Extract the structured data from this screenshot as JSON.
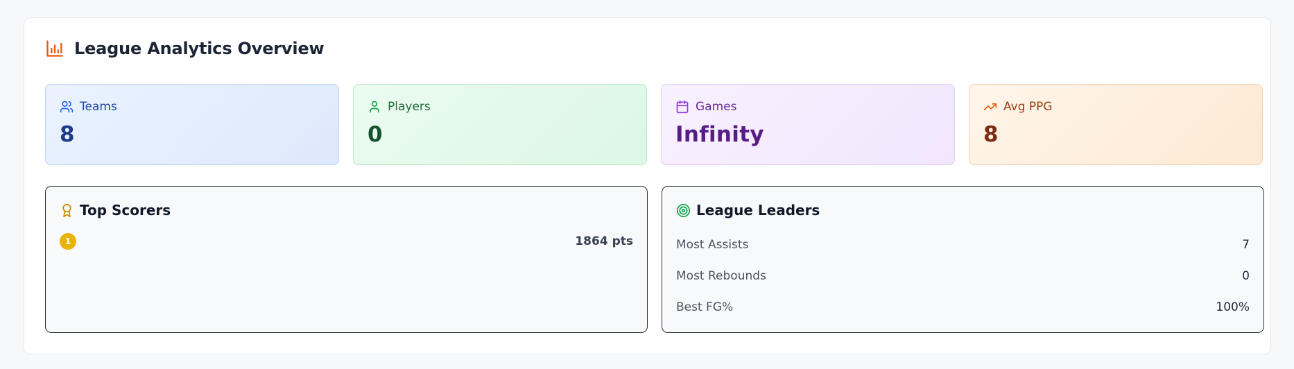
{
  "header": {
    "title": "League Analytics Overview",
    "icon": "bar-chart-icon",
    "accent": "#ea580c"
  },
  "stats": [
    {
      "label": "Teams",
      "value": "8",
      "icon": "users-icon",
      "color": "#2563eb"
    },
    {
      "label": "Players",
      "value": "0",
      "icon": "user-icon",
      "color": "#16a34a"
    },
    {
      "label": "Games",
      "value": "Infinity",
      "icon": "calendar-icon",
      "color": "#9333ea"
    },
    {
      "label": "Avg PPG",
      "value": "8",
      "icon": "trending-up-icon",
      "color": "#ea580c"
    }
  ],
  "top_scorers": {
    "title": "Top Scorers",
    "icon": "award-icon",
    "rows": [
      {
        "rank": "1",
        "points": "1864 pts"
      }
    ]
  },
  "league_leaders": {
    "title": "League Leaders",
    "icon": "target-icon",
    "rows": [
      {
        "label": "Most Assists",
        "value": "7"
      },
      {
        "label": "Most Rebounds",
        "value": "0"
      },
      {
        "label": "Best FG%",
        "value": "100%"
      }
    ]
  }
}
